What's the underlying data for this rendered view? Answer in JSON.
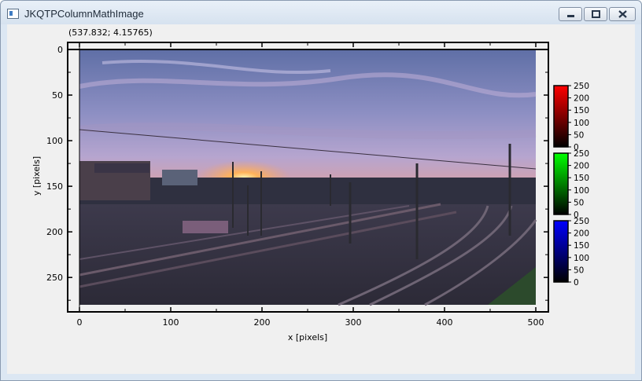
{
  "window": {
    "title": "JKQTPColumnMathImage"
  },
  "status": {
    "coords": "(537.832; 4.15765)"
  },
  "plot": {
    "xlabel": "x [pixels]",
    "ylabel": "y [pixels]",
    "xticks": [
      "0",
      "100",
      "200",
      "300",
      "400",
      "500"
    ],
    "yticks": [
      "0",
      "50",
      "100",
      "150",
      "200",
      "250"
    ],
    "xlim": [
      0,
      500
    ],
    "ylim": [
      0,
      280
    ],
    "image_description_icon": "sunset-railway-photo"
  },
  "colorbars": [
    {
      "name": "red-channel",
      "color": "#ff0000",
      "ticks": [
        "250",
        "200",
        "150",
        "100",
        "50",
        "0"
      ]
    },
    {
      "name": "green-channel",
      "color": "#00ff00",
      "ticks": [
        "250",
        "200",
        "150",
        "100",
        "50",
        "0"
      ]
    },
    {
      "name": "blue-channel",
      "color": "#0000ff",
      "ticks": [
        "250",
        "200",
        "150",
        "100",
        "50",
        "0"
      ]
    }
  ]
}
